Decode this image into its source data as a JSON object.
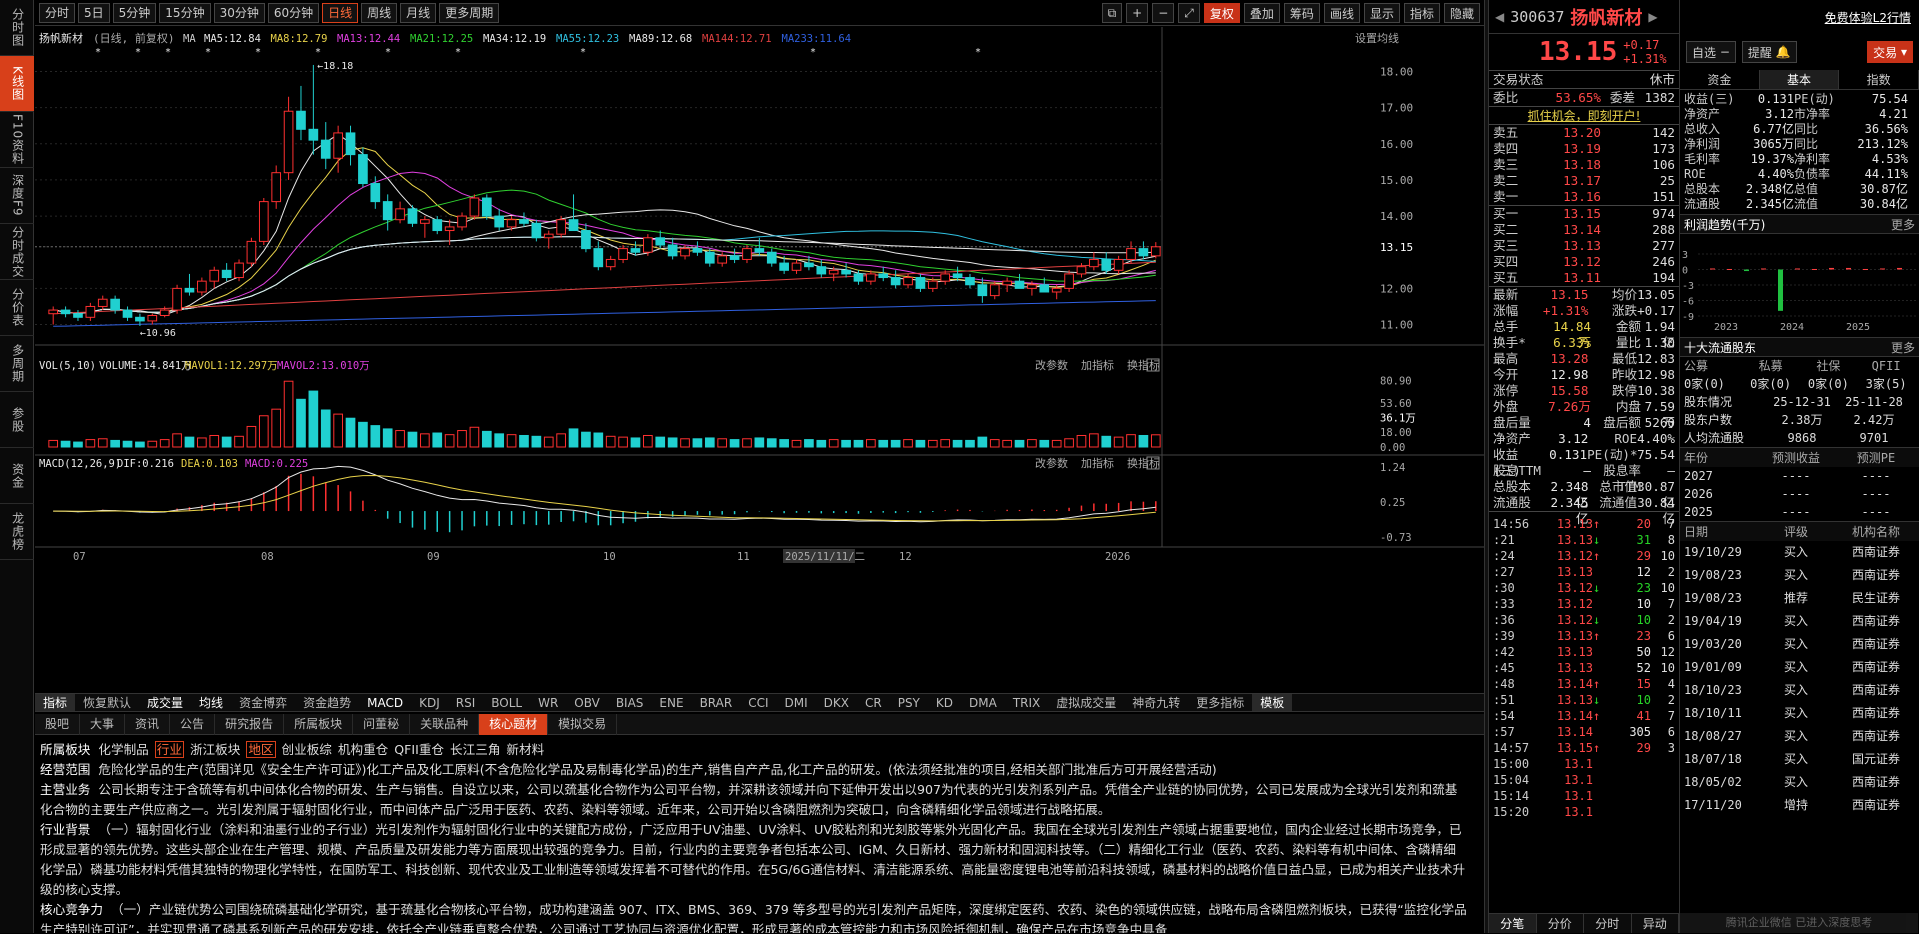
{
  "left_nav": [
    "分时图",
    "K线图",
    "F10资料",
    "深度F9",
    "分时成交",
    "分价表",
    "多周期",
    "参股",
    "资金",
    "龙虎榜"
  ],
  "left_nav_active": 1,
  "toolbar": {
    "periods": [
      "分时",
      "5日",
      "5分钟",
      "15分钟",
      "30分钟",
      "60分钟",
      "日线",
      "周线",
      "月线",
      "更多周期"
    ],
    "active": 6,
    "right": [
      "复权",
      "叠加",
      "筹码",
      "画线",
      "显示",
      "指标",
      "隐藏"
    ]
  },
  "chart": {
    "stock": "扬帆新材",
    "mode": "(日线, 前复权)",
    "ma_items": [
      {
        "t": "MA",
        "c": "#cccccc"
      },
      {
        "t": "MA5:12.84",
        "c": "#e8e8e8"
      },
      {
        "t": "MA8:12.79",
        "c": "#e8d24a"
      },
      {
        "t": "MA13:12.44",
        "c": "#e040e0"
      },
      {
        "t": "MA21:12.25",
        "c": "#30d030"
      },
      {
        "t": "MA34:12.19",
        "c": "#e8e8e8"
      },
      {
        "t": "MA55:12.23",
        "c": "#30c0e0"
      },
      {
        "t": "MA89:12.68",
        "c": "#e8e8e8"
      },
      {
        "t": "MA144:12.71",
        "c": "#e04040"
      },
      {
        "t": "MA233:11.64",
        "c": "#3060e0"
      }
    ],
    "settings": "设置均线",
    "y_labels": [
      "18.00",
      "17.00",
      "16.00",
      "15.00",
      "14.00",
      "13.15",
      "12.00",
      "11.00"
    ],
    "hi_label": "18.18",
    "lo_label": "10.96",
    "x_labels": [
      "07",
      "08",
      "09",
      "10",
      "11",
      "2025/11/11/二",
      "12",
      "2026"
    ],
    "vol_legend": [
      "VOL(5,10)",
      "VOLUME:14.841万",
      "MAVOL1:12.297万",
      "MAVOL2:13.010万"
    ],
    "vol_y": [
      "80.90",
      "53.60",
      "36.1万",
      "18.00",
      "0.00"
    ],
    "macd_legend": [
      "MACD(12,26,9)",
      "DIF:0.216",
      "DEA:0.103",
      "MACD:0.225"
    ],
    "macd_y": [
      "1.24",
      "0.25",
      "-0.73"
    ],
    "sub_btns": [
      "改参数",
      "加指标",
      "换指标"
    ]
  },
  "chart_data": {
    "type": "candlestick",
    "title": "扬帆新材 日线",
    "price_ylim": [
      10.6,
      18.4
    ],
    "candles": [
      [
        11.3,
        11.5,
        11.0,
        11.4
      ],
      [
        11.4,
        11.5,
        11.2,
        11.3
      ],
      [
        11.3,
        11.4,
        11.1,
        11.2
      ],
      [
        11.2,
        11.6,
        11.1,
        11.5
      ],
      [
        11.5,
        11.8,
        11.4,
        11.7
      ],
      [
        11.7,
        11.8,
        11.3,
        11.4
      ],
      [
        11.4,
        11.5,
        11.1,
        11.2
      ],
      [
        11.2,
        11.3,
        10.96,
        11.1
      ],
      [
        11.1,
        11.3,
        11.0,
        11.25
      ],
      [
        11.25,
        11.5,
        11.2,
        11.4
      ],
      [
        11.4,
        12.1,
        11.3,
        12.0
      ],
      [
        12.0,
        12.4,
        11.8,
        11.9
      ],
      [
        11.9,
        12.3,
        11.8,
        12.2
      ],
      [
        12.2,
        12.6,
        12.0,
        12.5
      ],
      [
        12.5,
        12.7,
        12.2,
        12.3
      ],
      [
        12.3,
        12.8,
        12.2,
        12.7
      ],
      [
        12.7,
        13.4,
        12.6,
        13.3
      ],
      [
        13.3,
        14.5,
        13.2,
        14.4
      ],
      [
        14.4,
        15.4,
        14.2,
        15.2
      ],
      [
        15.2,
        17.3,
        15.0,
        16.9
      ],
      [
        16.9,
        17.6,
        16.1,
        16.4
      ],
      [
        16.4,
        18.18,
        15.7,
        16.1
      ],
      [
        16.1,
        16.6,
        15.3,
        15.6
      ],
      [
        15.6,
        16.5,
        15.2,
        16.3
      ],
      [
        16.3,
        16.5,
        15.4,
        15.7
      ],
      [
        15.7,
        15.9,
        14.8,
        14.9
      ],
      [
        14.9,
        15.1,
        14.2,
        14.4
      ],
      [
        14.4,
        14.6,
        13.6,
        13.9
      ],
      [
        13.9,
        14.4,
        13.8,
        14.2
      ],
      [
        14.2,
        14.3,
        13.7,
        13.8
      ],
      [
        13.8,
        14.0,
        13.4,
        13.9
      ],
      [
        13.9,
        14.0,
        13.5,
        13.6
      ],
      [
        13.6,
        13.9,
        13.2,
        13.7
      ],
      [
        13.7,
        14.1,
        13.6,
        14.0
      ],
      [
        14.0,
        14.6,
        13.9,
        14.5
      ],
      [
        14.5,
        14.6,
        13.9,
        14.0
      ],
      [
        14.0,
        14.2,
        13.6,
        13.7
      ],
      [
        13.7,
        14.0,
        13.6,
        13.9
      ],
      [
        13.9,
        14.1,
        13.7,
        13.8
      ],
      [
        13.8,
        13.9,
        13.3,
        13.4
      ],
      [
        13.4,
        13.6,
        13.1,
        13.5
      ],
      [
        13.5,
        14.0,
        13.4,
        13.9
      ],
      [
        13.9,
        14.6,
        13.8,
        13.6
      ],
      [
        13.6,
        13.8,
        13.0,
        13.1
      ],
      [
        13.1,
        13.3,
        12.5,
        12.6
      ],
      [
        12.6,
        12.9,
        12.5,
        12.8
      ],
      [
        12.8,
        13.2,
        12.7,
        13.1
      ],
      [
        13.1,
        13.3,
        12.9,
        13.0
      ],
      [
        13.0,
        13.5,
        12.9,
        13.4
      ],
      [
        13.4,
        13.6,
        13.1,
        13.2
      ],
      [
        13.2,
        13.4,
        12.8,
        12.9
      ],
      [
        12.9,
        13.2,
        12.8,
        13.1
      ],
      [
        13.1,
        13.3,
        12.9,
        13.0
      ],
      [
        13.0,
        13.1,
        12.6,
        12.7
      ],
      [
        12.7,
        13.0,
        12.6,
        12.9
      ],
      [
        12.9,
        13.1,
        12.7,
        12.8
      ],
      [
        12.8,
        13.2,
        12.7,
        13.1
      ],
      [
        13.1,
        13.4,
        12.9,
        13.0
      ],
      [
        13.0,
        13.1,
        12.6,
        12.7
      ],
      [
        12.7,
        12.9,
        12.4,
        12.5
      ],
      [
        12.5,
        12.8,
        12.4,
        12.7
      ],
      [
        12.7,
        12.9,
        12.5,
        12.6
      ],
      [
        12.6,
        12.8,
        12.3,
        12.4
      ],
      [
        12.4,
        12.6,
        12.2,
        12.5
      ],
      [
        12.5,
        12.7,
        12.3,
        12.4
      ],
      [
        12.4,
        12.5,
        12.1,
        12.2
      ],
      [
        12.2,
        12.5,
        12.1,
        12.4
      ],
      [
        12.4,
        12.6,
        12.2,
        12.3
      ],
      [
        12.3,
        12.5,
        12.0,
        12.1
      ],
      [
        12.1,
        12.4,
        12.0,
        12.3
      ],
      [
        12.3,
        12.4,
        11.9,
        12.0
      ],
      [
        12.0,
        12.3,
        11.9,
        12.2
      ],
      [
        12.2,
        12.5,
        12.1,
        12.4
      ],
      [
        12.4,
        12.6,
        12.2,
        12.3
      ],
      [
        12.3,
        12.4,
        12.0,
        12.1
      ],
      [
        12.1,
        12.3,
        11.6,
        11.8
      ],
      [
        11.8,
        12.2,
        11.7,
        12.1
      ],
      [
        12.1,
        12.3,
        11.9,
        12.2
      ],
      [
        12.2,
        12.4,
        12.0,
        12.0
      ],
      [
        12.0,
        12.2,
        11.8,
        12.1
      ],
      [
        12.1,
        12.3,
        11.9,
        11.9
      ],
      [
        11.9,
        12.1,
        11.7,
        12.0
      ],
      [
        12.0,
        12.5,
        11.9,
        12.4
      ],
      [
        12.4,
        12.7,
        12.3,
        12.6
      ],
      [
        12.6,
        13.0,
        12.5,
        12.8
      ],
      [
        12.8,
        13.0,
        12.4,
        12.5
      ],
      [
        12.5,
        12.9,
        12.4,
        12.8
      ],
      [
        12.8,
        13.3,
        12.7,
        13.1
      ],
      [
        13.1,
        13.3,
        12.8,
        12.9
      ],
      [
        12.9,
        13.28,
        12.83,
        13.15
      ]
    ],
    "volume": [
      8,
      7,
      6,
      9,
      10,
      8,
      7,
      6,
      7,
      9,
      16,
      12,
      11,
      14,
      12,
      13,
      25,
      38,
      46,
      80,
      58,
      68,
      45,
      40,
      35,
      30,
      26,
      22,
      20,
      18,
      16,
      17,
      15,
      20,
      24,
      19,
      16,
      15,
      14,
      13,
      12,
      16,
      22,
      18,
      17,
      13,
      12,
      11,
      14,
      12,
      11,
      10,
      10,
      11,
      10,
      9,
      10,
      11,
      10,
      9,
      8,
      9,
      8,
      9,
      8,
      8,
      9,
      8,
      8,
      9,
      8,
      8,
      9,
      8,
      8,
      12,
      9,
      8,
      8,
      9,
      8,
      8,
      10,
      14,
      16,
      13,
      12,
      15,
      14,
      14.84
    ],
    "macd_ylim": [
      -0.73,
      1.24
    ]
  },
  "quote": {
    "code": "300637",
    "name": "扬帆新材",
    "l2": "免费体验L2行情",
    "price": "13.15",
    "chg": "+0.17",
    "pct": "+1.31%",
    "btn_watch": "自选",
    "btn_alert": "提醒",
    "btn_trade": "交易",
    "status_label": "交易状态",
    "status": "休市",
    "ratio_label": "委比",
    "ratio": "53.65%",
    "diff_label": "委差",
    "diff": "1382",
    "promo": "抓住机会，即刻开户!",
    "sells": [
      [
        "卖五",
        "13.20",
        "142"
      ],
      [
        "卖四",
        "13.19",
        "173"
      ],
      [
        "卖三",
        "13.18",
        "106"
      ],
      [
        "卖二",
        "13.17",
        "25"
      ],
      [
        "卖一",
        "13.16",
        "151"
      ]
    ],
    "buys": [
      [
        "买一",
        "13.15",
        "974"
      ],
      [
        "买二",
        "13.14",
        "288"
      ],
      [
        "买三",
        "13.13",
        "277"
      ],
      [
        "买四",
        "13.12",
        "246"
      ],
      [
        "买五",
        "13.11",
        "194"
      ]
    ],
    "stats": [
      [
        "最新",
        "13.15",
        "up",
        "均价",
        "13.05",
        "up"
      ],
      [
        "涨幅",
        "+1.31%",
        "up",
        "涨跌",
        "+0.17",
        "up"
      ],
      [
        "总手",
        "14.84万",
        "yel",
        "金额",
        "1.94亿",
        "yel"
      ],
      [
        "换手*",
        "6.33%",
        "yel",
        "量比",
        "1.30",
        "up"
      ],
      [
        "最高",
        "13.28",
        "up",
        "最低",
        "12.83",
        "dn"
      ],
      [
        "今开",
        "12.98",
        "wht",
        "昨收",
        "12.98",
        "wht"
      ],
      [
        "涨停",
        "15.58",
        "up",
        "跌停",
        "10.38",
        "dn"
      ],
      [
        "外盘",
        "7.26万",
        "up",
        "内盘",
        "7.59万",
        "dn"
      ],
      [
        "盘后量",
        "4",
        "wht",
        "盘后额",
        "5260",
        "cy"
      ],
      [
        "净资产",
        "3.12",
        "wht",
        "ROE",
        "4.40%",
        "wht"
      ],
      [
        "收益(三)",
        "0.131",
        "wht",
        "PE(动)*",
        "75.54",
        "wht"
      ],
      [
        "股息TTM",
        "—",
        "wht",
        "股息率TTM",
        "—",
        "wht"
      ],
      [
        "总股本",
        "2.348亿",
        "wht",
        "总市值",
        "30.87亿",
        "wht"
      ],
      [
        "流通股",
        "2.345亿",
        "wht",
        "流通值",
        "30.84亿",
        "wht"
      ]
    ],
    "ticks": [
      [
        "14:56",
        "13.13",
        "↑",
        "20",
        "7",
        "up"
      ],
      [
        ":21",
        "13.13",
        "↓",
        "31",
        "8",
        "dn"
      ],
      [
        ":24",
        "13.12",
        "↑",
        "29",
        "10",
        "up"
      ],
      [
        ":27",
        "13.13",
        "",
        "12",
        "2",
        "wht"
      ],
      [
        ":30",
        "13.12",
        "↓",
        "23",
        "10",
        "dn"
      ],
      [
        ":33",
        "13.12",
        "",
        "10",
        "7",
        "wht"
      ],
      [
        ":36",
        "13.12",
        "↓",
        "10",
        "2",
        "dn"
      ],
      [
        ":39",
        "13.13",
        "↑",
        "23",
        "6",
        "up"
      ],
      [
        ":42",
        "13.13",
        "",
        "50",
        "12",
        "wht"
      ],
      [
        ":45",
        "13.13",
        "",
        "52",
        "10",
        "wht"
      ],
      [
        ":48",
        "13.14",
        "↑",
        "15",
        "4",
        "up"
      ],
      [
        ":51",
        "13.13",
        "↓",
        "10",
        "2",
        "dn"
      ],
      [
        ":54",
        "13.14",
        "↑",
        "41",
        "7",
        "up"
      ],
      [
        ":57",
        "13.14",
        "",
        "305",
        "6",
        "wht"
      ],
      [
        "14:57",
        "13.15",
        "↑",
        "29",
        "3",
        "up"
      ],
      [
        "15:00",
        "13.1",
        "",
        "",
        "",
        "wht"
      ],
      [
        "15:04",
        "13.1",
        "",
        "",
        "",
        "wht"
      ],
      [
        "15:14",
        "13.1",
        "",
        "",
        "",
        "wht"
      ],
      [
        "15:20",
        "13.1",
        "",
        "",
        "",
        "wht"
      ]
    ],
    "bottom_tabs": [
      "分笔",
      "分价",
      "分时",
      "异动"
    ]
  },
  "fundamental": {
    "tabs": [
      "资金",
      "基本",
      "指数"
    ],
    "active": 1,
    "kv": [
      [
        "收益(三)",
        "0.131",
        "PE(动)",
        "75.54"
      ],
      [
        "净资产",
        "3.12",
        "市净率",
        "4.21"
      ],
      [
        "总收入",
        "6.77亿",
        "同比",
        "36.56%"
      ],
      [
        "净利润",
        "3065万",
        "同比",
        "213.12%"
      ],
      [
        "毛利率",
        "19.37%",
        "净利率",
        "4.53%"
      ],
      [
        "ROE",
        "4.40%",
        "负债率",
        "44.11%"
      ],
      [
        "总股本",
        "2.348亿",
        "总值",
        "30.87亿"
      ],
      [
        "流通股",
        "2.345亿",
        "流值",
        "30.84亿"
      ]
    ],
    "profit_title": "利润趋势(千万)",
    "more": "更多",
    "profit_y": [
      "3",
      "0",
      "-3",
      "-6",
      "-9"
    ],
    "profit_x": [
      "2023",
      "2024",
      "2025"
    ],
    "profit_bars": [
      0.2,
      0.1,
      -0.3,
      0.2,
      -8.0,
      0.2,
      0.1,
      0.3,
      0.3,
      0.1,
      0.2,
      0.3
    ],
    "holders_title": "十大流通股东",
    "holders_head": [
      "公募",
      "私募",
      "社保",
      "QFII"
    ],
    "holders_vals": [
      "0家(0)",
      "0家(0)",
      "0家(0)",
      "3家(5)"
    ],
    "holders_rows": [
      [
        "股东情况",
        "25-12-31",
        "25-11-28"
      ],
      [
        "股东户数",
        "2.38万",
        "2.42万"
      ],
      [
        "人均流通股",
        "9868",
        "9701"
      ]
    ],
    "fc_head": [
      "年份",
      "预测收益",
      "预测PE"
    ],
    "fc_rows": [
      [
        "2027",
        "----",
        "----"
      ],
      [
        "2026",
        "----",
        "----"
      ],
      [
        "2025",
        "----",
        "----"
      ]
    ],
    "rating_head": [
      "日期",
      "评级",
      "机构名称"
    ],
    "ratings": [
      [
        "19/10/29",
        "买入",
        "西南证券"
      ],
      [
        "19/08/23",
        "买入",
        "西南证券"
      ],
      [
        "19/08/23",
        "推荐",
        "民生证券"
      ],
      [
        "19/04/19",
        "买入",
        "西南证券"
      ],
      [
        "19/03/20",
        "买入",
        "西南证券"
      ],
      [
        "19/01/09",
        "买入",
        "西南证券"
      ],
      [
        "18/10/23",
        "买入",
        "西南证券"
      ],
      [
        "18/10/11",
        "买入",
        "西南证券"
      ],
      [
        "18/08/27",
        "买入",
        "西南证券"
      ],
      [
        "18/07/18",
        "买入",
        "国元证券"
      ],
      [
        "18/05/02",
        "买入",
        "西南证券"
      ],
      [
        "17/11/20",
        "增持",
        "西南证券"
      ]
    ],
    "watermark": "腾讯企业微信 已进入深度思考"
  },
  "indicator_tabs": [
    "指标",
    "恢复默认",
    "成交量",
    "均线",
    "资金博弈",
    "资金趋势",
    "MACD",
    "KDJ",
    "RSI",
    "BOLL",
    "WR",
    "OBV",
    "BIAS",
    "ENE",
    "BRAR",
    "CCI",
    "DMI",
    "DKX",
    "CR",
    "PSY",
    "KD",
    "DMA",
    "TRIX",
    "虚拟成交量",
    "神奇九转",
    "更多指标",
    "模板"
  ],
  "f10_tabs": [
    "股吧",
    "大事",
    "资讯",
    "公告",
    "研究报告",
    "所属板块",
    "问董秘",
    "关联品种",
    "核心题材",
    "模拟交易"
  ],
  "f10_active": 8,
  "f10": {
    "board_label": "所属板块",
    "boards": [
      [
        "化学制品",
        "行业"
      ],
      [
        "浙江板块",
        "地区"
      ],
      [
        "创业板综",
        ""
      ],
      [
        "机构重仓",
        ""
      ],
      [
        "QFII重仓",
        ""
      ],
      [
        "长江三角",
        ""
      ],
      [
        "新材料",
        ""
      ]
    ],
    "scope_label": "经营范围",
    "scope": "危险化学品的生产(范围详见《安全生产许可证》)化工产品及化工原料(不含危险化学品及易制毒化学品)的生产,销售自产产品,化工产品的研发。(依法须经批准的项目,经相关部门批准后方可开展经营活动)",
    "main_label": "主营业务",
    "main": "公司长期专注于含硫等有机中间体化合物的研发、生产与销售。自设立以来，公司以巯基化合物作为公司平台物，并深耕该领域并向下延伸开发出以907为代表的光引发剂系列产品。凭借全产业链的协同优势，公司已发展成为全球光引发剂和巯基化合物的主要生产供应商之一。光引发剂属于辐射固化行业，而中间体产品广泛用于医药、农药、染料等领域。近年来，公司开始以含磷阻燃剂为突破口，向含磷精细化学品领域进行战略拓展。",
    "bg_label": "行业背景",
    "bg": "（一）辐射固化行业（涂料和油墨行业的子行业）光引发剂作为辐射固化行业中的关键配方成份，广泛应用于UV油墨、UV涂料、UV胶粘剂和光刻胶等紫外光固化产品。我国在全球光引发剂生产领域占据重要地位，国内企业经过长期市场竞争，已形成显著的领先优势。这些头部企业在生产管理、规模、产品质量及研发能力等方面展现出较强的竞争力。目前，行业内的主要竞争者包括本公司、IGM、久日新材、强力新材和固润科技等。（二）精细化工行业（医药、农药、染料等有机中间体、含磷精细化学品）磷基功能材料凭借其独特的物理化学特性，在国防军工、科技创新、现代农业及工业制造等领域发挥着不可替代的作用。在5G/6G通信材料、清洁能源系统、高能量密度锂电池等前沿科技领域，磷基材料的战略价值日益凸显，已成为相关产业技术升级的核心支撑。",
    "core_label": "核心竞争力",
    "core": "（一）产业链优势公司围绕硫磷基础化学研究，基于巯基化合物核心平台物，成功构建涵盖 907、ITX、BMS、369、379 等多型号的光引发剂产品矩阵，深度绑定医药、农药、染色的领域供应链，战略布局含磷阻燃剂板块，已获得“监控化学品生产特别许可证”，并实现贯通了磷基系列新产品的研发安排，依托全产业链垂直整合优势，公司通过工艺协同与资源优化配置，形成显著的成本管控能力和市场风险抵御机制，确保产品在市场竞争中具备"
  }
}
